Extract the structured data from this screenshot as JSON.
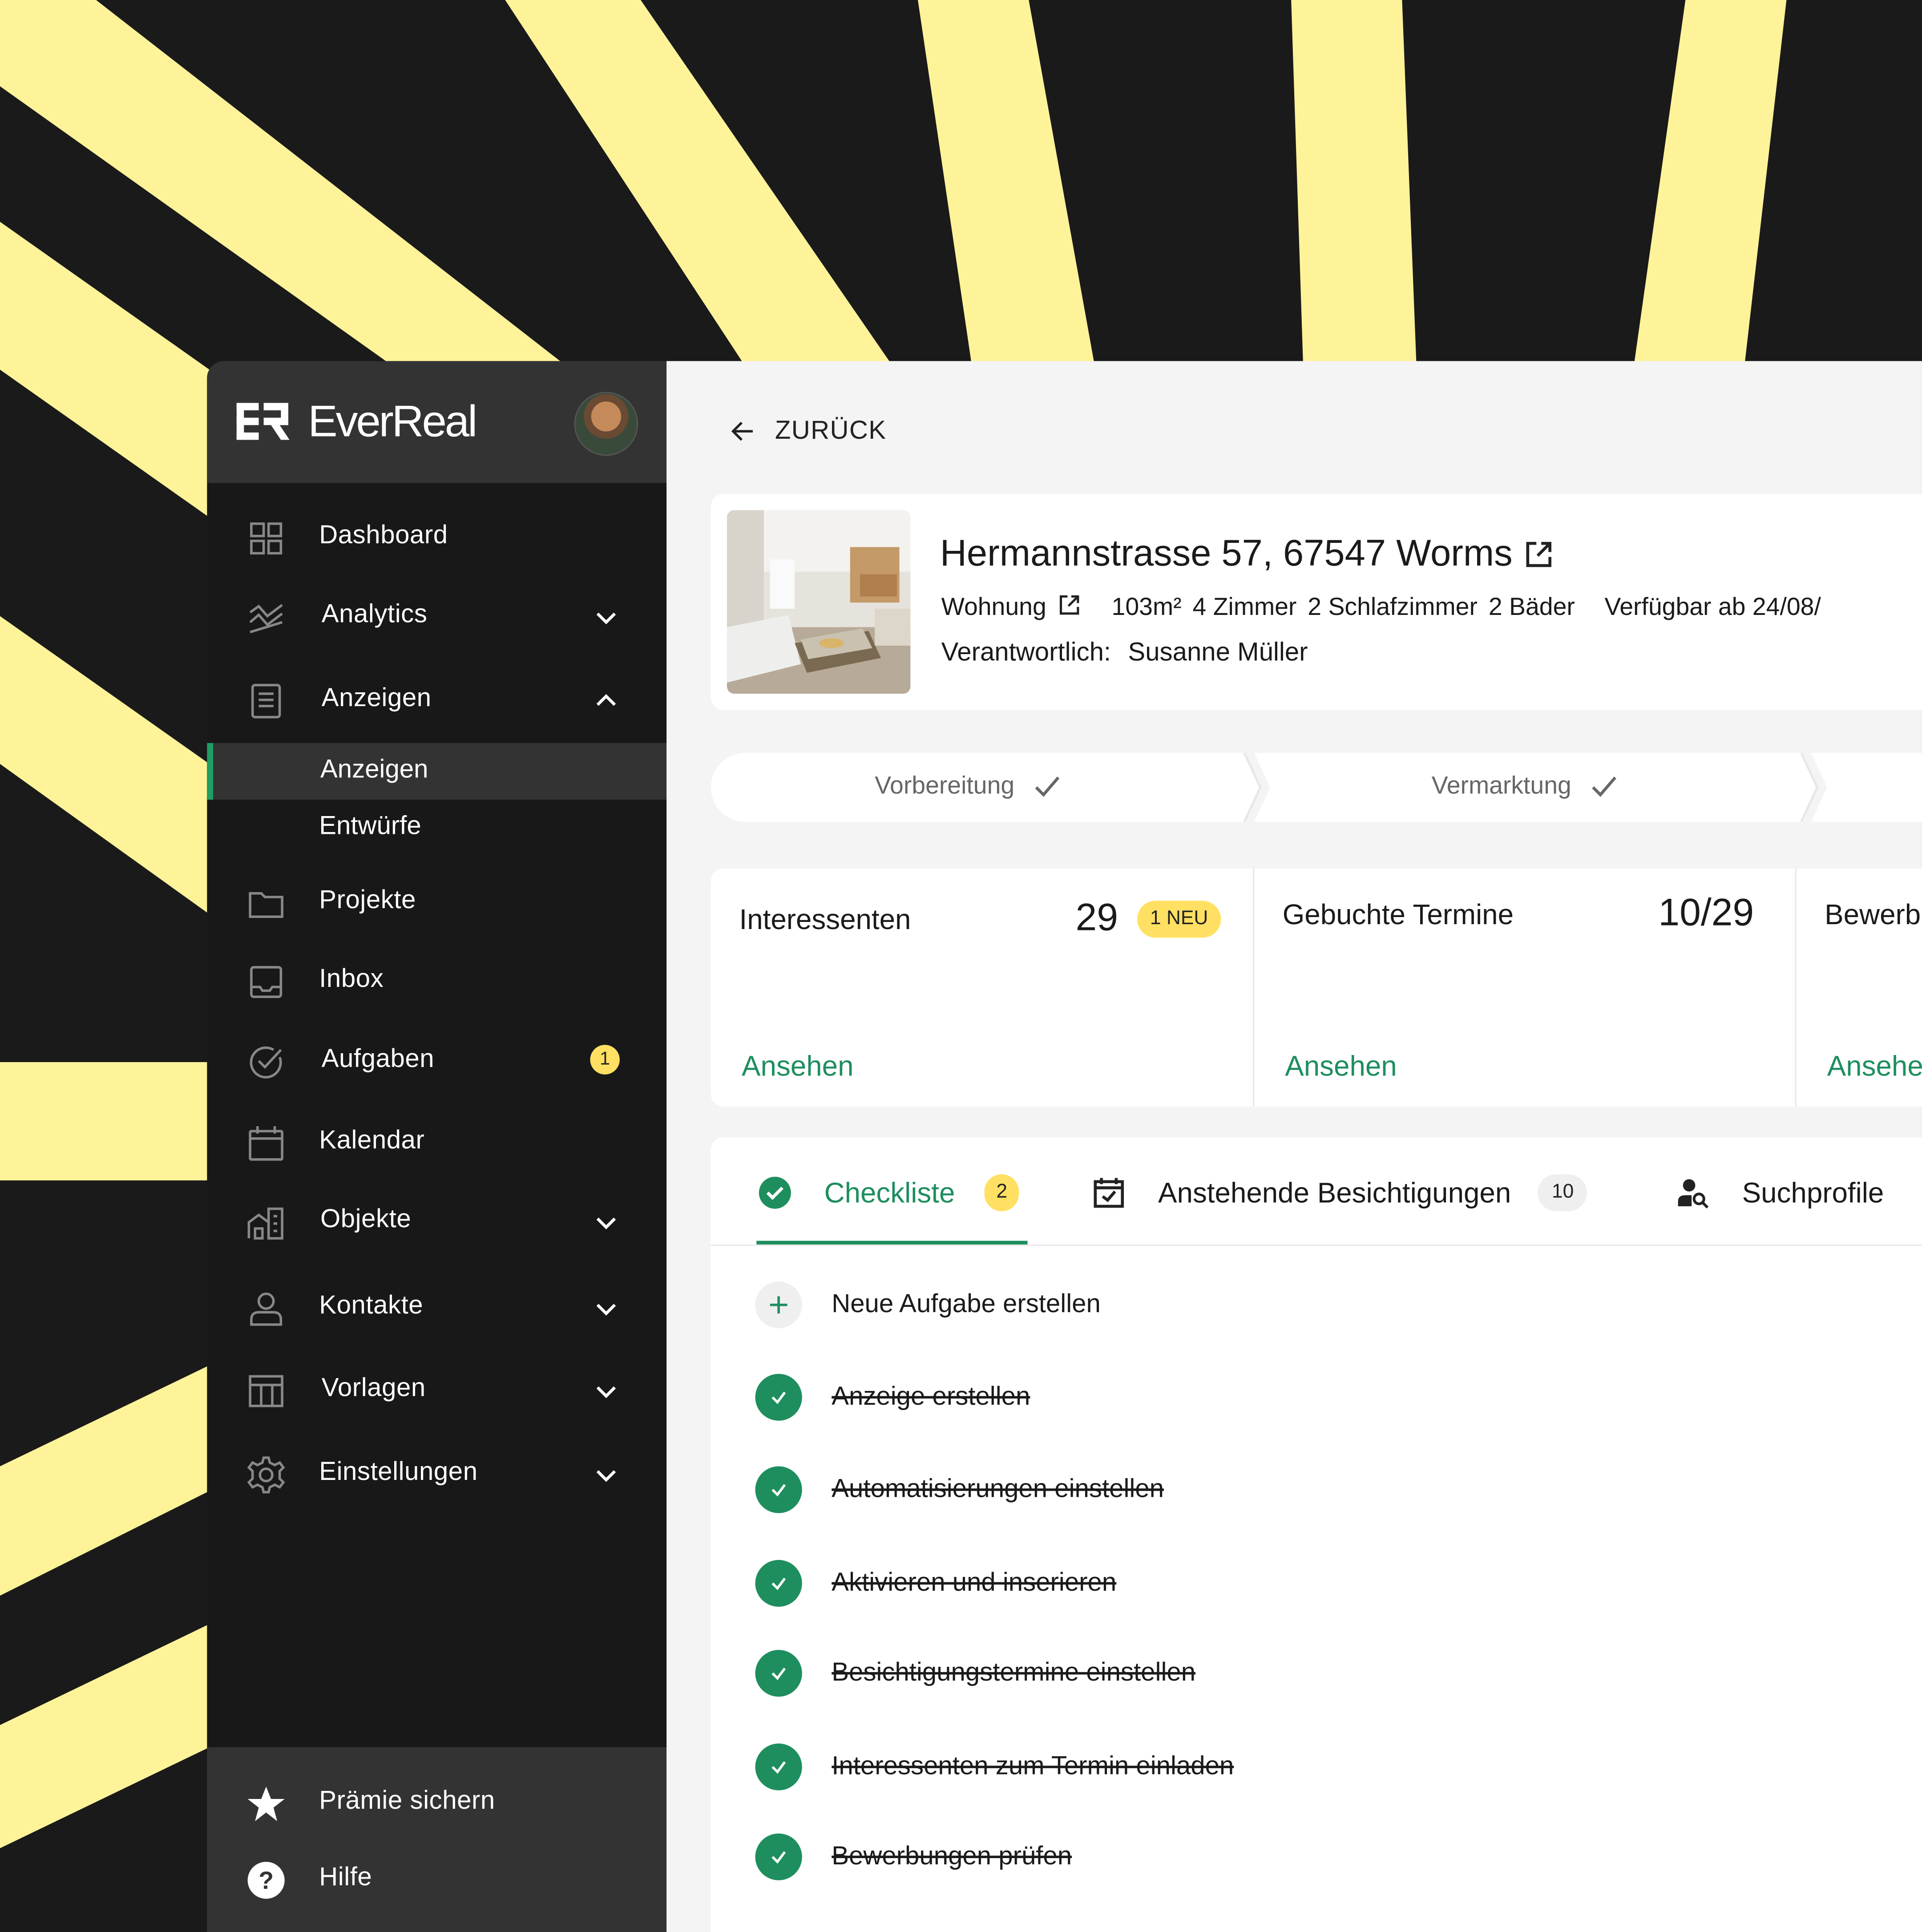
{
  "colors": {
    "accent": "#1e8e5e",
    "highlight": "#ffe062",
    "ray": "#fff39a",
    "background": "#1a1a1a",
    "sidebar": "#181818"
  },
  "app": {
    "logo_text": "EverReal"
  },
  "sidebar": {
    "items": [
      {
        "label": "Dashboard",
        "icon": "dashboard-icon"
      },
      {
        "label": "Analytics",
        "icon": "analytics-icon",
        "expandable": true
      },
      {
        "label": "Anzeigen",
        "icon": "listing-icon",
        "expanded": true,
        "children": [
          {
            "label": "Anzeigen",
            "active": true
          },
          {
            "label": "Entwürfe"
          }
        ]
      },
      {
        "label": "Projekte",
        "icon": "folder-icon"
      },
      {
        "label": "Inbox",
        "icon": "inbox-icon"
      },
      {
        "label": "Aufgaben",
        "icon": "task-check-icon",
        "badge": "1"
      },
      {
        "label": "Kalendar",
        "icon": "calendar-icon"
      },
      {
        "label": "Objekte",
        "icon": "building-icon",
        "expandable": true
      },
      {
        "label": "Kontakte",
        "icon": "person-icon",
        "expandable": true
      },
      {
        "label": "Vorlagen",
        "icon": "template-icon",
        "expandable": true
      },
      {
        "label": "Einstellungen",
        "icon": "gear-icon",
        "expandable": true
      }
    ],
    "footer": [
      {
        "label": "Prämie sichern",
        "icon": "star-icon"
      },
      {
        "label": "Hilfe",
        "icon": "help-icon"
      }
    ]
  },
  "main": {
    "back_label": "ZURÜCK",
    "property": {
      "address": "Hermannstrasse 57, 67547 Worms",
      "type": "Wohnung",
      "area": "103m²",
      "rooms": "4 Zimmer",
      "bedrooms": "2 Schlafzimmer",
      "bathrooms": "2 Bäder",
      "available": "Verfügbar ab 24/08/",
      "responsible_label": "Verantwortlich:",
      "responsible_name": "Susanne Müller"
    },
    "steps": [
      {
        "label": "Vorbereitung",
        "done": true
      },
      {
        "label": "Vermarktung",
        "done": true
      }
    ],
    "stats": [
      {
        "title": "Interessenten",
        "value": "29",
        "badge": "1 NEU",
        "link": "Ansehen"
      },
      {
        "title": "Gebuchte Termine",
        "value": "10/29",
        "link": "Ansehen"
      },
      {
        "title": "Bewerb",
        "link": "Ansehe"
      }
    ],
    "tabs": [
      {
        "label": "Checkliste",
        "count": "2",
        "active": true
      },
      {
        "label": "Anstehende Besichtigungen",
        "count": "10"
      },
      {
        "label": "Suchprofile"
      }
    ],
    "new_task_label": "Neue Aufgabe erstellen",
    "tasks": [
      {
        "label": "Anzeige erstellen",
        "done": true
      },
      {
        "label": "Automatisierungen einstellen",
        "done": true
      },
      {
        "label": "Aktivieren und inserieren",
        "done": true
      },
      {
        "label": "Besichtigungstermine einstellen",
        "done": true
      },
      {
        "label": "Interessenten zum Termin einladen",
        "done": true
      },
      {
        "label": "Bewerbungen prüfen",
        "done": true
      }
    ]
  }
}
